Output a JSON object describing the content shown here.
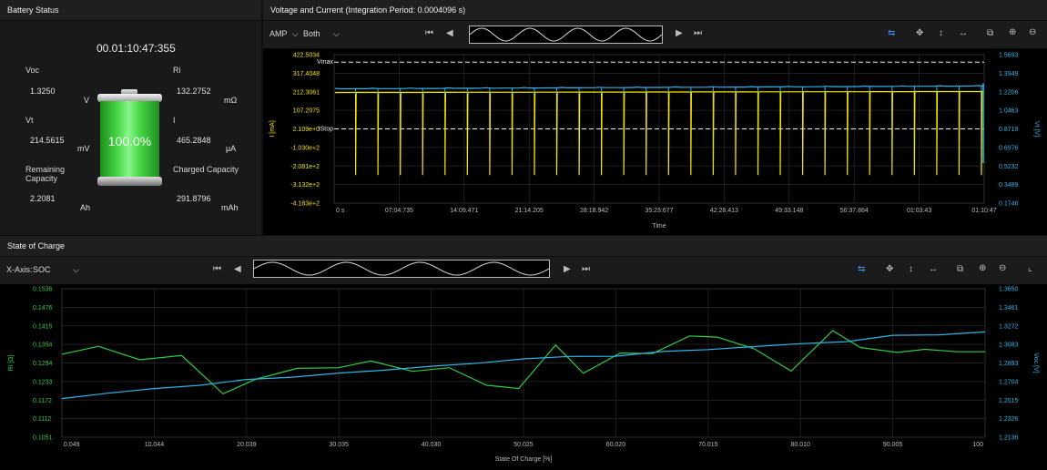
{
  "battery": {
    "title": "Battery Status",
    "time": "00.01:10:47:355",
    "percent": "100.0%",
    "fill_level": 1.0,
    "voc": {
      "label": "Voc",
      "value": "1.3250",
      "unit": "V"
    },
    "ri": {
      "label": "Ri",
      "value": "132.2752",
      "unit": "mΩ"
    },
    "vt": {
      "label": "Vt",
      "value": "214.5615",
      "unit": "mV"
    },
    "i": {
      "label": "I",
      "value": "465.2848",
      "unit": "μA"
    },
    "remaining": {
      "label1": "Remaining",
      "label2": "Capacity",
      "value": "2.2081",
      "unit": "Ah"
    },
    "charged": {
      "label": "Charged Capacity",
      "value": "291.8796",
      "unit": "mAh"
    }
  },
  "vc": {
    "title": "Voltage and Current (Integration Period: 0.0004096 s)",
    "mode": "AMP",
    "display": "Both",
    "ylabel_left": "I [mA]",
    "ylabel_right": "Vt [V]",
    "xlabel": "Time",
    "vmax_label": "Vmax",
    "istop_label": "IStop",
    "colors": {
      "current": "#f2e600",
      "voltage": "#2fb4e8",
      "axis_left": "#f2e600",
      "axis_right": "#2fb4e8"
    }
  },
  "soc": {
    "title": "State of Charge",
    "xaxis_label": "X-Axis:",
    "xaxis_value": "SOC",
    "ylabel_left": "Ri [Ω]",
    "ylabel_right": "Voc [V]",
    "xlabel": "State Of Charge [%]",
    "colors": {
      "ri": "#2ecc40",
      "voc": "#2fb4e8",
      "axis_left": "#2ecc40",
      "axis_right": "#2fb4e8"
    }
  },
  "chart_data": [
    {
      "type": "line",
      "title": "Voltage and Current (Integration Period: 0.0004096 s)",
      "xlabel": "Time",
      "ylabel_left": "I [mA]",
      "ylabel_right": "Vt [V]",
      "x_ticks": [
        "0 s",
        "07:04.735",
        "14:09.471",
        "21:14.205",
        "28:18.942",
        "35:23.677",
        "42:28.413",
        "49:33.148",
        "56:37.884",
        "01:03:43",
        "01:10:47"
      ],
      "y_left_ticks": [
        "422.5034",
        "317.4048",
        "212.3061",
        "107.2075",
        "2.109e+0",
        "-1.030e+2",
        "-2.081e+2",
        "-3.132e+2",
        "-4.183e+2"
      ],
      "y_right_ticks": [
        "1.5693",
        "1.3949",
        "1.2206",
        "1.0463",
        "0.8719",
        "0.6976",
        "0.5232",
        "0.3489",
        "0.1746"
      ],
      "ylim_left": [
        -418.3,
        422.5034
      ],
      "ylim_right": [
        0.1746,
        1.5693
      ],
      "vmax_current_equiv": 380,
      "istop": 2.109,
      "pulse_count": 29,
      "pulse_bottom": -260,
      "series": [
        {
          "name": "I",
          "baseline": 208,
          "end": 214
        },
        {
          "name": "Vt",
          "start": 1.248,
          "end": 1.275
        }
      ],
      "grid": true
    },
    {
      "type": "line",
      "title": "State of Charge",
      "xlabel": "State Of Charge [%]",
      "ylabel_left": "Ri [Ω]",
      "ylabel_right": "Voc [V]",
      "x_ticks": [
        "0.049",
        "10.044",
        "20.039",
        "30.035",
        "40.030",
        "50.025",
        "60.020",
        "70.015",
        "80.010",
        "90.005",
        "100"
      ],
      "y_left_ticks": [
        "0.1536",
        "0.1476",
        "0.1415",
        "0.1354",
        "0.1294",
        "0.1233",
        "0.1172",
        "0.1112",
        "0.1051"
      ],
      "y_right_ticks": [
        "1.3650",
        "1.3461",
        "1.3272",
        "1.3083",
        "1.2893",
        "1.2704",
        "1.2515",
        "1.2326",
        "1.2136"
      ],
      "xlim": [
        0.049,
        100
      ],
      "ylim_left": [
        0.1051,
        0.1536
      ],
      "ylim_right": [
        1.2136,
        1.365
      ],
      "series": [
        {
          "name": "Ri",
          "x": [
            0.049,
            4,
            8.5,
            13,
            17.5,
            21,
            25.5,
            30,
            33.5,
            38,
            42,
            46,
            49.5,
            53.5,
            56.5,
            60.5,
            64,
            68,
            71,
            75,
            79,
            83.5,
            86.5,
            90.5,
            93.5,
            97,
            100
          ],
          "y": [
            0.1322,
            0.1348,
            0.1304,
            0.1318,
            0.1193,
            0.124,
            0.1276,
            0.1278,
            0.13,
            0.1266,
            0.1278,
            0.1221,
            0.121,
            0.1352,
            0.126,
            0.1326,
            0.1324,
            0.1382,
            0.1378,
            0.134,
            0.1267,
            0.1399,
            0.1344,
            0.1328,
            0.1338,
            0.133,
            0.133
          ]
        },
        {
          "name": "Voc",
          "x": [
            0.049,
            5,
            10,
            15,
            20,
            25,
            30,
            35,
            40,
            45,
            50,
            55,
            60,
            65,
            70,
            75,
            80,
            85,
            90,
            95,
            100
          ],
          "y": [
            1.253,
            1.2585,
            1.2632,
            1.2665,
            1.2725,
            1.2748,
            1.279,
            1.282,
            1.286,
            1.289,
            1.2935,
            1.296,
            1.2962,
            1.301,
            1.303,
            1.306,
            1.309,
            1.311,
            1.3175,
            1.318,
            1.321
          ]
        }
      ],
      "grid": true
    }
  ]
}
